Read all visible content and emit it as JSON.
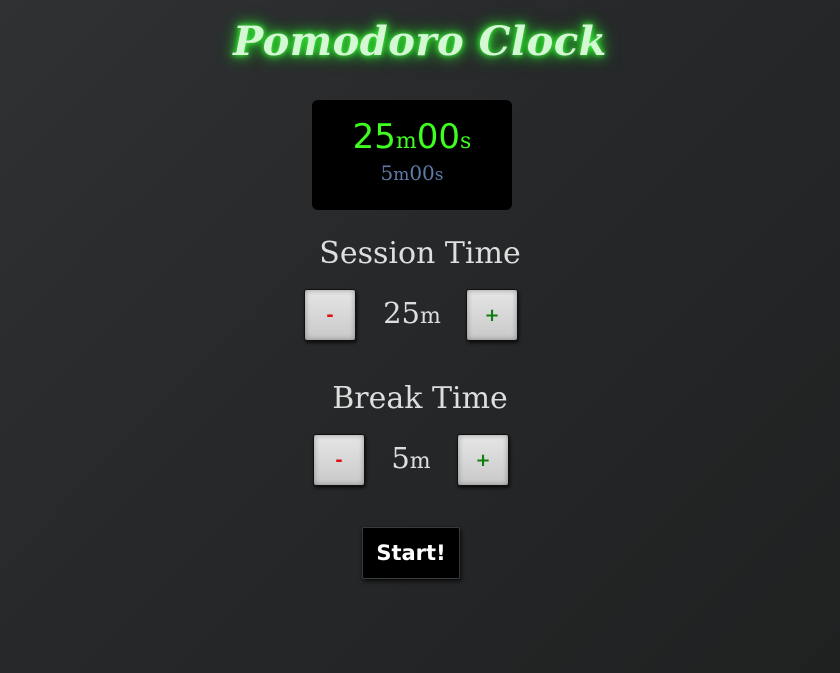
{
  "app": {
    "title": "Pomodoro Clock"
  },
  "display": {
    "session_minutes": "25",
    "session_minutes_unit": "m",
    "session_seconds": "00",
    "session_seconds_unit": "s",
    "break_minutes": "5",
    "break_minutes_unit": "m",
    "break_seconds": "00",
    "break_seconds_unit": "s"
  },
  "session": {
    "label": "Session Time",
    "decrement_label": "-",
    "increment_label": "+",
    "value": "25",
    "unit": "m"
  },
  "break": {
    "label": "Break Time",
    "decrement_label": "-",
    "increment_label": "+",
    "value": "5",
    "unit": "m"
  },
  "controls": {
    "start_label": "Start!"
  },
  "colors": {
    "timer_main": "#3fff1f",
    "timer_sub": "#5f7aa8",
    "minus": "#e01010",
    "plus": "#0f7f0f",
    "title_glow": "#3dff3d"
  }
}
